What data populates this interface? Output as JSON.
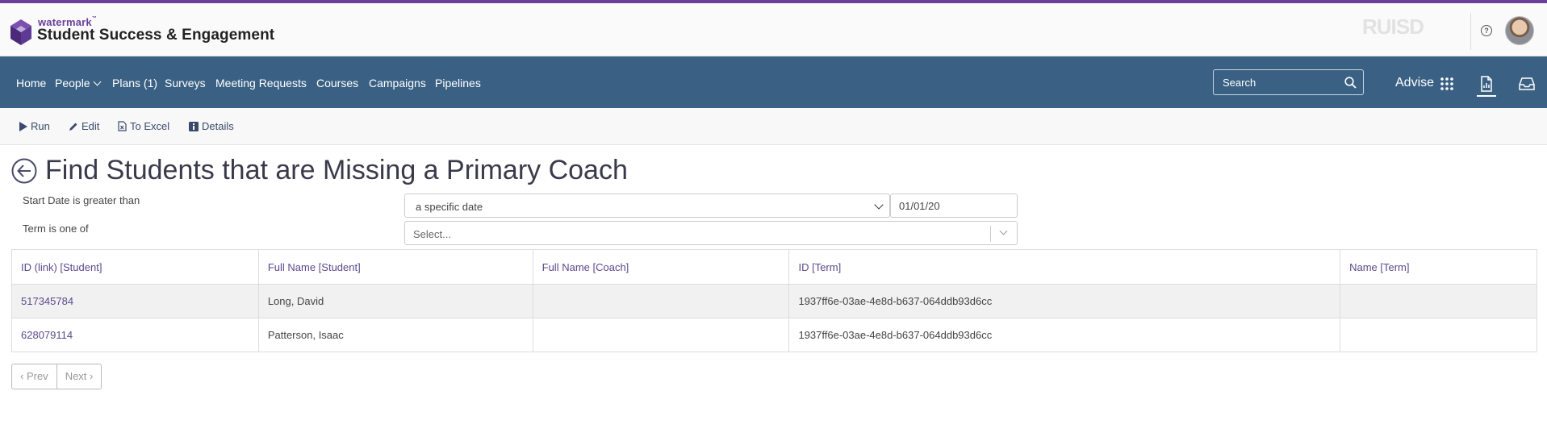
{
  "header": {
    "brand_small": "watermark",
    "brand_tm": "™",
    "brand_big": "Student Success & Engagement",
    "institution_logo_text": "RUISD"
  },
  "nav": {
    "items": [
      {
        "label": "Home"
      },
      {
        "label": "People"
      },
      {
        "label": "Plans (1)"
      },
      {
        "label": "Surveys"
      },
      {
        "label": "Meeting Requests"
      },
      {
        "label": "Courses"
      },
      {
        "label": "Campaigns"
      },
      {
        "label": "Pipelines"
      }
    ],
    "search_placeholder": "Search",
    "advise_label": "Advise"
  },
  "toolbar": {
    "run_label": "Run",
    "edit_label": "Edit",
    "excel_label": "To Excel",
    "details_label": "Details"
  },
  "page": {
    "title": "Find Students that are Missing a Primary Coach"
  },
  "filters": {
    "start_date_label": "Start Date is greater than",
    "date_mode": "a specific date",
    "date_value": "01/01/20",
    "term_label": "Term is one of",
    "term_placeholder": "Select..."
  },
  "table": {
    "columns": [
      "ID (link) [Student]",
      "Full Name [Student]",
      "Full Name [Coach]",
      "ID [Term]",
      "Name [Term]"
    ],
    "rows": [
      {
        "id": "517345784",
        "student_name": "Long, David",
        "coach_name": "",
        "term_id": "1937ff6e-03ae-4e8d-b637-064ddb93d6cc",
        "term_name": ""
      },
      {
        "id": "628079114",
        "student_name": "Patterson, Isaac",
        "coach_name": "",
        "term_id": "1937ff6e-03ae-4e8d-b637-064ddb93d6cc",
        "term_name": ""
      }
    ]
  },
  "pager": {
    "prev_label": "Prev",
    "next_label": "Next"
  },
  "colors": {
    "accent_purple": "#6a3f9a",
    "nav_blue": "#3a6184",
    "link_purple": "#5a4a8a"
  }
}
